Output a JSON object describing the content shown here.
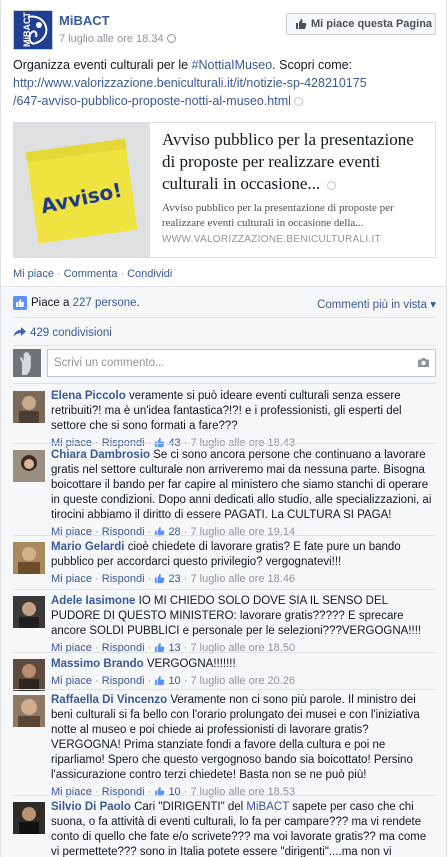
{
  "post": {
    "page_name": "MiBACT",
    "avatar_text": "MiBACT",
    "timestamp": "7 luglio alle ore 18.34",
    "like_page_label": "Mi piace questa Pagina",
    "text_intro": "Organizza eventi culturali per le ",
    "hashtag": "#NottiaIMuseo",
    "text_after_hashtag": ". Scopri come:",
    "url_line1": "http://www.valorizzazione.beniculturali.it/it/notizie-sp-428210175",
    "url_line2": "/647-avviso-pubblico-proposte-notti-al-museo.html"
  },
  "preview": {
    "image_text": "Avviso!",
    "title": "Avviso pubblico per la presentazione di proposte per realizzare eventi culturali in occasione...",
    "description": "Avviso pubblico per la presentazione di proposte per realizzare eventi culturali in occasione della...",
    "domain": "WWW.VALORIZZAZIONE.BENICULTURALI.IT"
  },
  "actions": {
    "like": "Mi piace",
    "comment": "Commenta",
    "share": "Condividi",
    "separator": "·"
  },
  "ufi": {
    "likes_prefix": "Piace a ",
    "likes_count": "227 persone",
    "likes_suffix": ".",
    "sort_label": "Commenti più in vista",
    "sort_caret": "▾",
    "shares": "429 condivisioni",
    "comment_placeholder": "Scrivi un commento..."
  },
  "comment_meta": {
    "like": "Mi piace",
    "reply": "Rispondi",
    "dot": "·"
  },
  "comments": [
    {
      "author": "Elena Piccolo",
      "text": "veramente si può ideare eventi culturali senza essere retribuiti?! ma è un'idea fantastica?!?! e i professionisti, gli esperti del settore che si sono formati a fare???",
      "likes": "43",
      "time": "7 luglio alle ore 18.43"
    },
    {
      "author": "Chiara Dambrosio",
      "text": "Se ci sono ancora persone che continuano a lavorare gratis nel settore culturale non arriveremo mai da nessuna parte. Bisogna boicottare il bando per far capire al ministero che siamo stanchi di operare in queste condizioni. Dopo anni dedicati allo studio, alle specializzazioni, ai tirocini abbiamo il diritto di essere PAGATI. La CULTURA SI PAGA!",
      "likes": "28",
      "time": "7 luglio alle ore 19.14"
    },
    {
      "author": "Mario Gelardi",
      "text": "cioè chiedete di lavorare gratis? E fate pure un bando pubblico per accordarci questo privilegio? vergognatevi!!!",
      "likes": "23",
      "time": "7 luglio alle ore 18.46"
    },
    {
      "author": "Adele Iasimone",
      "text": "IO MI CHIEDO SOLO DOVE SIA IL SENSO DEL PUDORE DI QUESTO MINISTERO: lavorare gratis????? E sprecare ancore SOLDI PUBBLICI e personale per le selezioni???VERGOGNA!!!!",
      "likes": "13",
      "time": "7 luglio alle ore 18.50"
    },
    {
      "author": "Massimo Brando",
      "text": "VERGOGNA!!!!!!!",
      "likes": "10",
      "time": "7 luglio alle ore 20.26"
    },
    {
      "author": "Raffaella Di Vincenzo",
      "text": "Veramente non ci sono più parole. Il ministro dei beni culturali si fa bello con l'orario prolungato dei musei e con l'iniziativa notte al museo e poi chiede ai professionisti di lavorare gratis? VERGOGNA! Prima stanziate fondi a favore della cultura e poi ne riparliamo! Spero che questo vergognoso bando sia boicottato! Persino l'assicurazione contro terzi chiedete! Basta non se ne può più!",
      "likes": "10",
      "time": "7 luglio alle ore 18.53"
    },
    {
      "author": "Silvio Di Paolo",
      "text_before_tag": "Cari \"DIRIGENTI\" del ",
      "tag": "MiBACT",
      "text_after_tag": " sapete per caso che chi suona, o fa attività di eventi culturali, lo fa per campare??? ma vi rendete conto di quello che fate e/o scrivete??? ma voi lavorate gratis?? ma come vi permettete??? sono in Italia potete essere \"dirigenti\"....ma non vi vergognate???"
    }
  ],
  "colors": {
    "link": "#3b5998",
    "meta": "#90949c",
    "ufi_bg": "#f6f7f9",
    "note_yellow": "#f3e94a"
  }
}
